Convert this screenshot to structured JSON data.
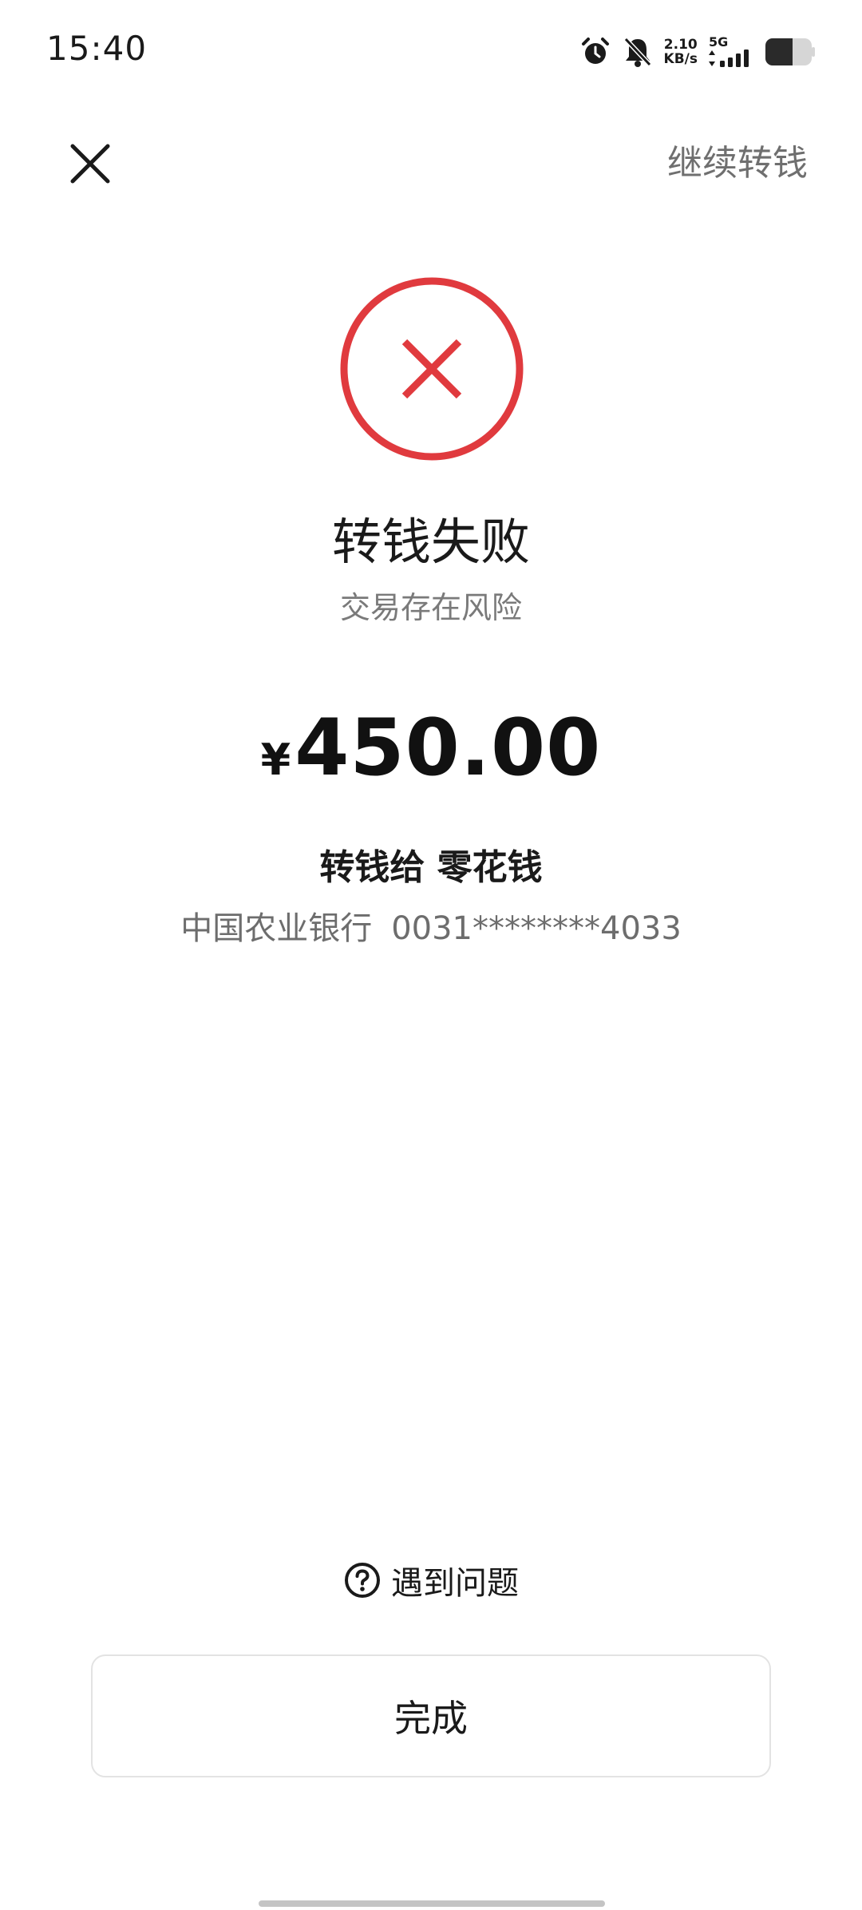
{
  "status_bar": {
    "time": "15:40",
    "net_speed_value": "2.10",
    "net_speed_unit": "KB/s",
    "network_type": "5G",
    "icons": [
      "alarm-icon",
      "bell-off-icon",
      "signal-icon",
      "battery-icon"
    ]
  },
  "header": {
    "close_icon": "close-icon",
    "continue_label": "继续转钱"
  },
  "result": {
    "status_icon": "error-circle-x-icon",
    "status_color": "#e03a3e",
    "title": "转钱失败",
    "subtitle": "交易存在风险"
  },
  "transfer": {
    "currency_symbol": "¥",
    "amount": "450.00",
    "recipient_line": "转钱给 零花钱",
    "bank_name": "中国农业银行",
    "account_masked": "0031********4033"
  },
  "help": {
    "icon": "question-circle-icon",
    "label": "遇到问题"
  },
  "footer": {
    "done_label": "完成"
  }
}
